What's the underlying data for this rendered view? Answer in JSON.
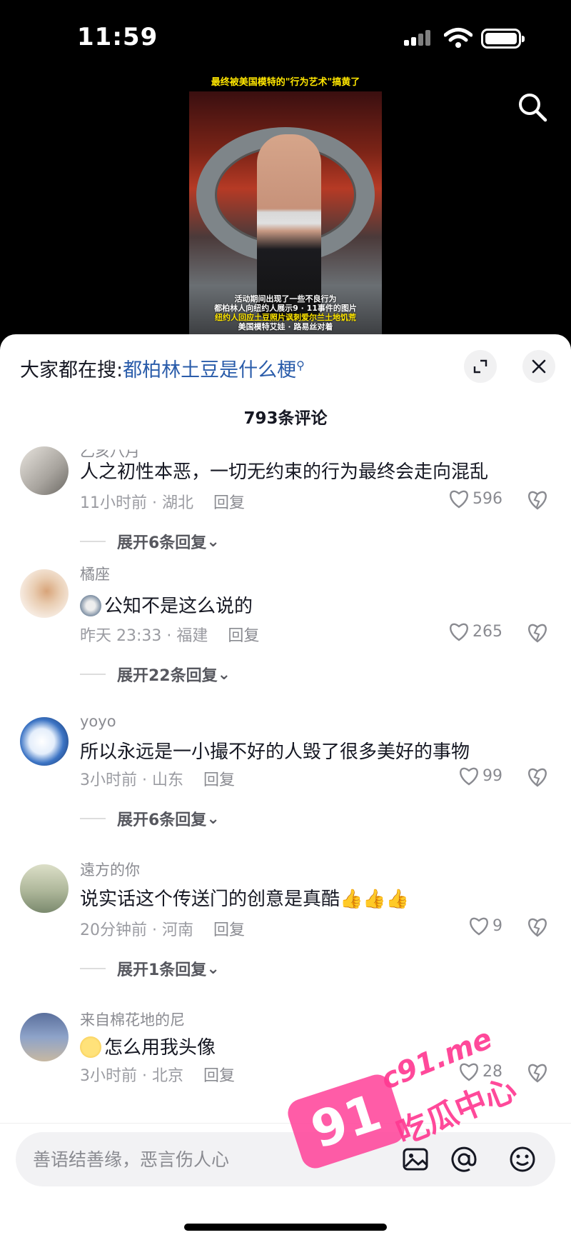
{
  "status_bar": {
    "time": "11:59"
  },
  "video": {
    "title": "最终被美国模特的\"行为艺术\"搞黄了",
    "caption_lines": [
      "活动期间出现了一些不良行为",
      "都柏林人向纽约人展示9 · 11事件的图片",
      "纽约人回应土豆照片讽刺爱尔兰土地饥荒",
      "美国模特艾娃 · 路易丝对着"
    ]
  },
  "search_hint": {
    "prefix": "大家都在搜:",
    "query": "都柏林土豆是什么梗"
  },
  "comments_count": "793条评论",
  "comments": [
    {
      "username": "乙亥八月",
      "text": "人之初性本恶，一切无约束的行为最终会走向混乱",
      "time": "11小时前 · 湖北",
      "reply": "回复",
      "likes": "596",
      "expand": "展开6条回复"
    },
    {
      "username": "橘座",
      "emoji": "cat-emoji",
      "text": "公知不是这么说的",
      "time": "昨天 23:33 · 福建",
      "reply": "回复",
      "likes": "265",
      "expand": "展开22条回复"
    },
    {
      "username": "yoyo",
      "text": "所以永远是一小撮不好的人毁了很多美好的事物",
      "time": "3小时前 · 山东",
      "reply": "回复",
      "likes": "99",
      "expand": "展开6条回复"
    },
    {
      "username": "遠方的你",
      "text": "说实话这个传送门的创意是真酷👍👍👍",
      "time": "20分钟前 · 河南",
      "reply": "回复",
      "likes": "9",
      "expand": "展开1条回复"
    },
    {
      "username": "来自棉花地的尼",
      "emoji": "flushed-emoji",
      "text": "怎么用我头像",
      "time": "3小时前 · 北京",
      "reply": "回复",
      "likes": "28"
    }
  ],
  "input": {
    "placeholder": "善语结善缘，恶言伤人心"
  },
  "watermark": {
    "badge": "91",
    "site": "c91.me",
    "cn": "吃瓜中心"
  },
  "colors": {
    "accent_link": "#2a5caa",
    "watermark_pink": "#ff3a92"
  }
}
